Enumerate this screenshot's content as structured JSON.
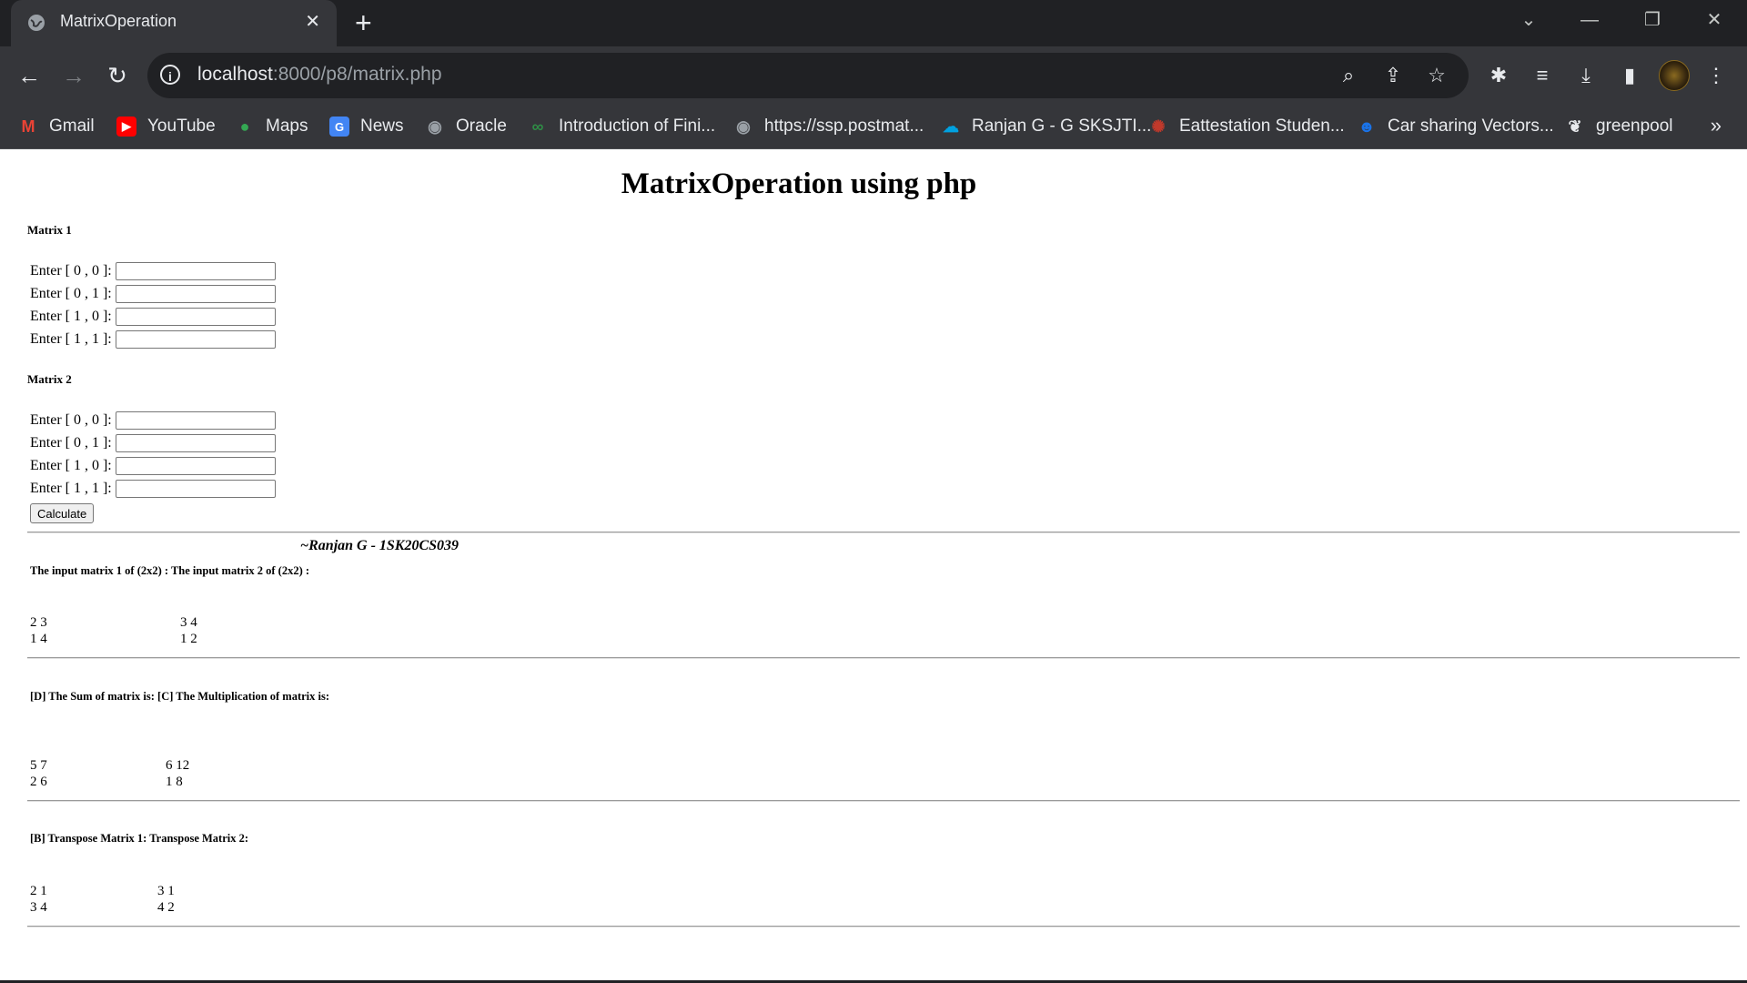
{
  "browser": {
    "tab_title": "MatrixOperation",
    "url_host": "localhost",
    "url_path": ":8000/p8/matrix.php",
    "bookmarks": [
      {
        "label": "Gmail",
        "icon": "gmail-icon",
        "color": "#ea4335"
      },
      {
        "label": "YouTube",
        "icon": "youtube-icon",
        "color": "#ff0000"
      },
      {
        "label": "Maps",
        "icon": "maps-icon",
        "color": "#34a853"
      },
      {
        "label": "News",
        "icon": "news-icon",
        "color": "#4285f4"
      },
      {
        "label": "Oracle",
        "icon": "globe-icon",
        "color": "#9aa0a6"
      },
      {
        "label": "Introduction of Fini...",
        "icon": "gfg-icon",
        "color": "#2f8d46"
      },
      {
        "label": "https://ssp.postmat...",
        "icon": "globe-icon",
        "color": "#9aa0a6"
      },
      {
        "label": "Ranjan G - G SKSJTI...",
        "icon": "salesforce-icon",
        "color": "#00a1e0"
      },
      {
        "label": "Eattestation Studen...",
        "icon": "emblem-icon",
        "color": "#c0392b"
      },
      {
        "label": "Car sharing Vectors...",
        "icon": "robot-icon",
        "color": "#1a73e8"
      },
      {
        "label": "greenpool",
        "icon": "leaf-icon",
        "color": "#e8eaed"
      }
    ]
  },
  "page": {
    "title": "MatrixOperation using php",
    "matrix1_label": "Matrix 1",
    "matrix2_label": "Matrix 2",
    "matrix1_fields": [
      "Enter [ 0 , 0 ]:",
      "Enter [ 0 , 1 ]:",
      "Enter [ 1 , 0 ]:",
      "Enter [ 1 , 1 ]:"
    ],
    "matrix2_fields": [
      "Enter [ 0 , 0 ]:",
      "Enter [ 0 , 1 ]:",
      "Enter [ 1 , 0 ]:",
      "Enter [ 1 , 1 ]:"
    ],
    "calculate_label": "Calculate",
    "author": "~Ranjan G - 1SK20CS039",
    "input_heading": "The input matrix 1 of (2x2) : The input matrix 2 of (2x2) :",
    "input_m1": [
      "2 3",
      "1 4"
    ],
    "input_m2": [
      "3 4",
      "1 2"
    ],
    "sum_heading": "[D] The Sum of matrix is: [C] The Multiplication of matrix is:",
    "sum": [
      "5 7",
      "2 6"
    ],
    "product": [
      "6 12",
      "1 8"
    ],
    "transpose_heading": "[B] Transpose Matrix 1: Transpose Matrix 2:",
    "transpose1": [
      "2 1",
      "3 4"
    ],
    "transpose2": [
      "3 1",
      "4 2"
    ]
  }
}
